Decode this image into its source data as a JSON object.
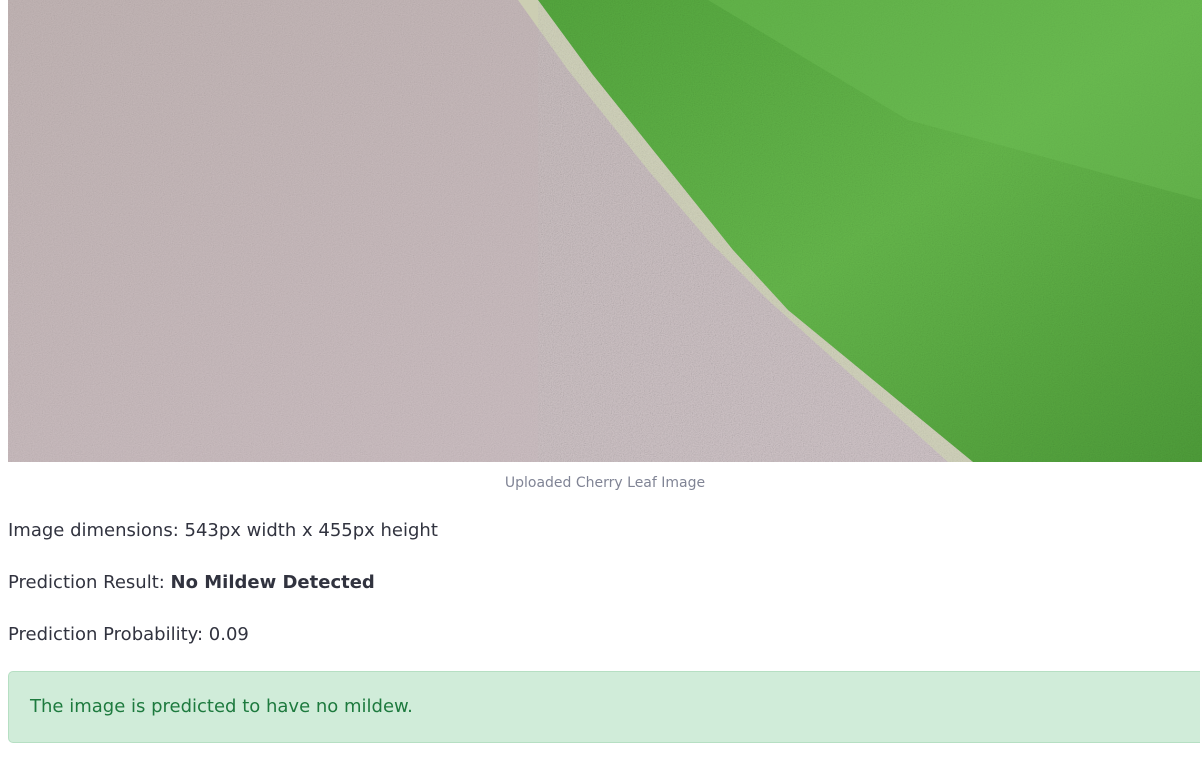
{
  "image": {
    "alt": "Uploaded cherry leaf close-up",
    "caption": "Uploaded Cherry Leaf Image"
  },
  "details": {
    "dimensions_text": "Image dimensions: 543px width x 455px height",
    "result_label": "Prediction Result: ",
    "result_value": "No Mildew Detected",
    "probability_text": "Prediction Probability: 0.09"
  },
  "alert": {
    "message": "The image is predicted to have no mildew."
  },
  "colors": {
    "alert_background": "#d0ecd9",
    "alert_text": "#1d7a3e",
    "leaf_green": "#5fb24a",
    "surface_pink": "#cbbcbd"
  }
}
